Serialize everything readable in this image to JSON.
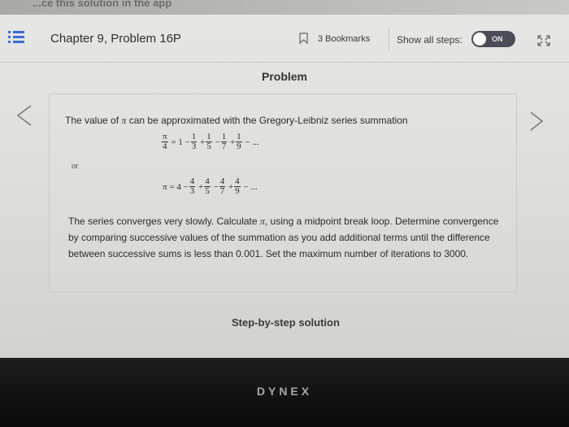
{
  "top_cut_text": "...ce this solution in the app",
  "header": {
    "menu_icon": "list-icon",
    "chapter_title": "Chapter 9, Problem 16P",
    "bookmark_icon": "bookmark-icon",
    "bookmarks_label": "3 Bookmarks",
    "show_steps_label": "Show all steps:",
    "toggle_state": "ON",
    "expand_icon": "expand-icon"
  },
  "section_title": "Problem",
  "problem": {
    "intro_prefix": "The value of ",
    "pi_symbol": "π",
    "intro_suffix": " can be approximated with the Gregory-Leibniz series summation",
    "eq1": {
      "lhs_num": "π",
      "lhs_den": "4",
      "equals": "=",
      "first": "1",
      "terms": [
        {
          "sign": "−",
          "num": "1",
          "den": "3"
        },
        {
          "sign": "+",
          "num": "1",
          "den": "5"
        },
        {
          "sign": "−",
          "num": "1",
          "den": "7"
        },
        {
          "sign": "+",
          "num": "1",
          "den": "9"
        },
        {
          "sign": "−",
          "num": "",
          "den": ""
        }
      ],
      "ellipsis": "..."
    },
    "or_label": "or",
    "eq2": {
      "lhs": "π",
      "equals": "=",
      "first": "4",
      "terms": [
        {
          "sign": "−",
          "num": "4",
          "den": "3"
        },
        {
          "sign": "+",
          "num": "4",
          "den": "5"
        },
        {
          "sign": "−",
          "num": "4",
          "den": "7"
        },
        {
          "sign": "+",
          "num": "4",
          "den": "9"
        },
        {
          "sign": "−",
          "num": "",
          "den": ""
        }
      ],
      "ellipsis": "..."
    },
    "paragraph_a": "The series converges very slowly. Calculate ",
    "paragraph_b": ", using a midpoint break loop. Determine convergence by comparing successive values of the summation as you add additional terms until the difference between successive sums is less than 0.001. Set the maximum number of iterations to 3000."
  },
  "step_by_step_label": "Step-by-step solution",
  "brand_label": "DYNEX",
  "colors": {
    "accent": "#3f6fd0",
    "toggle_bg": "#4a4d57"
  }
}
